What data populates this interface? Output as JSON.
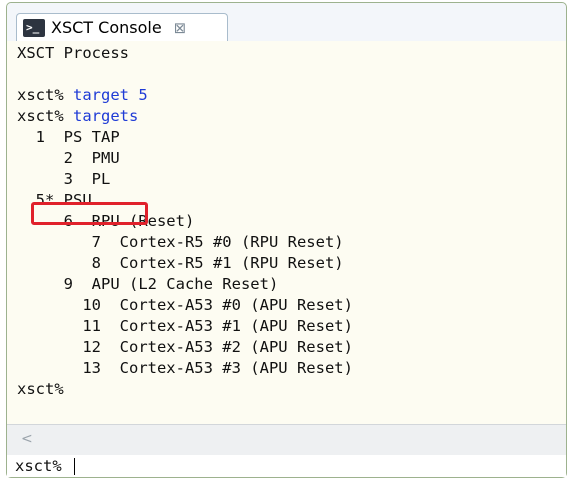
{
  "tab": {
    "icon_glyph": ">_",
    "title": "XSCT Console",
    "close_glyph": "⊠"
  },
  "output": {
    "process_label": "XSCT Process",
    "lines": [
      {
        "prompt": "xsct%",
        "command": " target 5"
      },
      {
        "prompt": "xsct%",
        "command": " targets"
      },
      {
        "text": "  1  PS TAP"
      },
      {
        "text": "     2  PMU"
      },
      {
        "text": "     3  PL"
      },
      {
        "text": "  5* PSU"
      },
      {
        "text": "     6  RPU (Reset)"
      },
      {
        "text": "        7  Cortex-R5 #0 (RPU Reset)"
      },
      {
        "text": "        8  Cortex-R5 #1 (RPU Reset)"
      },
      {
        "text": "     9  APU (L2 Cache Reset)"
      },
      {
        "text": "       10  Cortex-A53 #0 (APU Reset)"
      },
      {
        "text": "       11  Cortex-A53 #1 (APU Reset)"
      },
      {
        "text": "       12  Cortex-A53 #2 (APU Reset)"
      },
      {
        "text": "       13  Cortex-A53 #3 (APU Reset)"
      },
      {
        "text": "xsct%"
      }
    ]
  },
  "scrollbar": {
    "left_arrow": "<"
  },
  "input": {
    "value": "xsct%"
  },
  "colors": {
    "command": "#1f3bd6",
    "highlight": "#e0212b",
    "background": "#fdfcf2"
  }
}
